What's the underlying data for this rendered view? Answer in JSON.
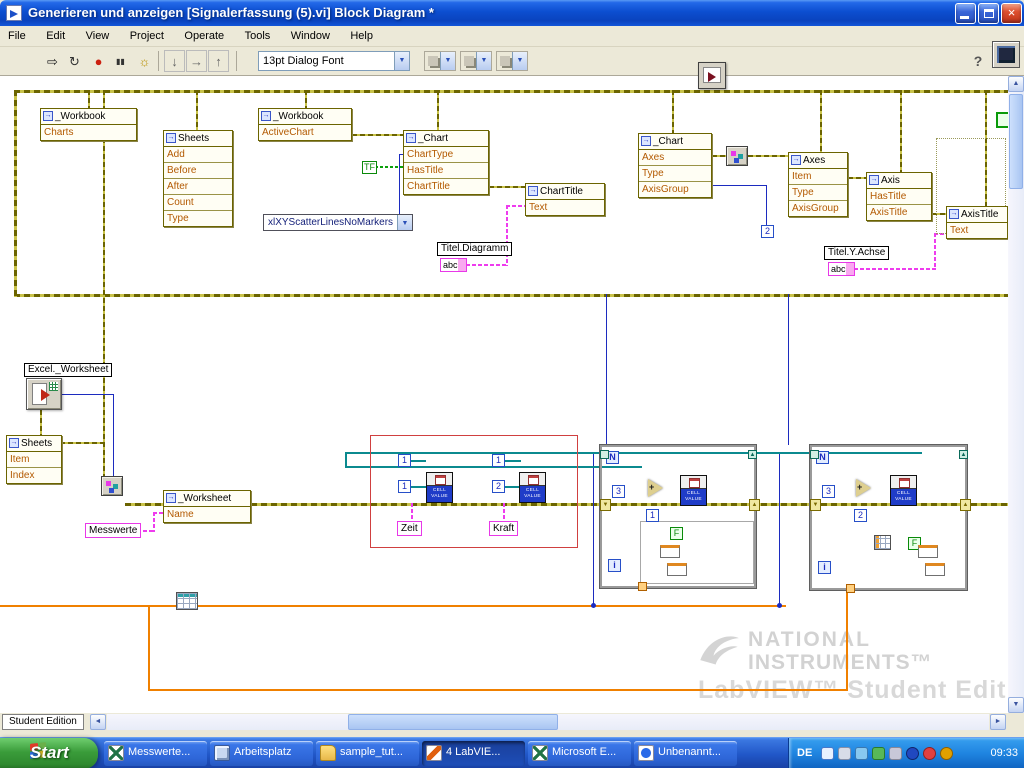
{
  "window": {
    "title": "Generieren und anzeigen [Signalerfassung (5).vi] Block Diagram *",
    "menus": [
      "File",
      "Edit",
      "View",
      "Project",
      "Operate",
      "Tools",
      "Window",
      "Help"
    ]
  },
  "toolbar": {
    "font": "13pt Dialog Font"
  },
  "icons": {
    "run": "⇨",
    "run_continuous": "↻",
    "abort": "●",
    "pause": "▮▮",
    "highlight": "☼",
    "step_into": "↓",
    "step_over": "→",
    "step_out": "↑",
    "dropdown": "▼",
    "up": "▲",
    "down": "▼",
    "left": "◄",
    "right": "►",
    "help": "?",
    "close": "×",
    "plus": "+",
    "refnum": "→"
  },
  "nodes": {
    "workbook1": {
      "title": "_Workbook",
      "rows": [
        "Charts"
      ]
    },
    "sheets1": {
      "title": "Sheets",
      "rows": [
        "Add",
        "Before",
        "After",
        "Count",
        "Type"
      ]
    },
    "workbook2": {
      "title": "_Workbook",
      "rows": [
        "ActiveChart"
      ]
    },
    "chart1": {
      "title": "_Chart",
      "rows": [
        "ChartType",
        "HasTitle",
        "ChartTitle"
      ]
    },
    "charttitle": {
      "title": "ChartTitle",
      "rows": [
        "Text"
      ]
    },
    "chart2": {
      "title": "_Chart",
      "rows": [
        "Axes",
        "Type",
        "AxisGroup"
      ]
    },
    "axes": {
      "title": "Axes",
      "rows": [
        "Item",
        "Type",
        "AxisGroup"
      ]
    },
    "axis": {
      "title": "Axis",
      "rows": [
        "HasTitle",
        "AxisTitle"
      ]
    },
    "axistitle": {
      "title": "AxisTitle",
      "rows": [
        "Text"
      ]
    },
    "sheets2": {
      "title": "Sheets",
      "rows": [
        "Item",
        "Index"
      ]
    },
    "worksheet": {
      "title": "_Worksheet",
      "rows": [
        "Name"
      ]
    },
    "enum_value": "xlXYScatterLinesNoMarkers"
  },
  "labels": {
    "titel_diagramm": "Titel.Diagramm",
    "titel_y_achse": "Titel.Y.Achse",
    "excel_worksheet": "Excel._Worksheet",
    "messwerte": "Messwerte",
    "zeit": "Zeit",
    "kraft": "Kraft",
    "abc": "abc",
    "tf": "TF",
    "f": "F",
    "cell_value": "CELL VALUE",
    "student_edition": "Student Edition"
  },
  "constants": {
    "one": "1",
    "two": "2",
    "three": "3",
    "n": "N",
    "i": "i"
  },
  "watermark": {
    "brand_top": "NATIONAL",
    "brand_bottom": "INSTRUMENTS™",
    "product": "LabVIEW™ Student Edition"
  },
  "taskbar": {
    "start": "Start",
    "items": [
      "Messwerte...",
      "Arbeitsplatz",
      "sample_tut...",
      "4 LabVIE...",
      "Microsoft E...",
      "Unbenannt..."
    ],
    "language": "DE",
    "time": "09:33"
  }
}
